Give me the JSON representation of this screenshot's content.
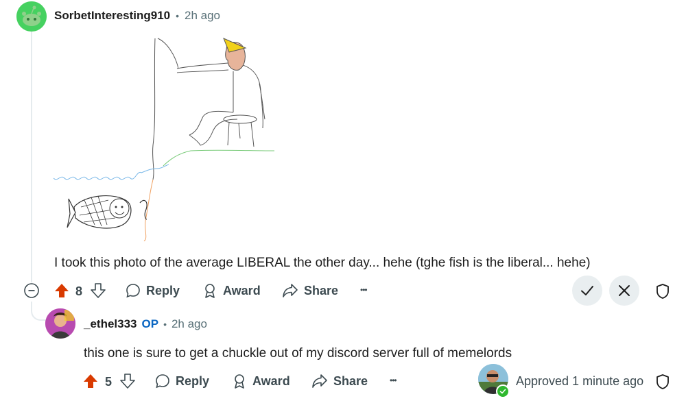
{
  "comment": {
    "username": "SorbetInteresting910",
    "separator": "•",
    "time": "2h ago",
    "text": "I took this photo of the average LIBERAL the other day... hehe (tghe fish is the liberal... hehe)",
    "votes": "8",
    "actions": {
      "reply": "Reply",
      "award": "Award",
      "share": "Share",
      "more": "•••"
    }
  },
  "reply": {
    "username": "_ethel333",
    "op_badge": "OP",
    "separator": "•",
    "time": "2h ago",
    "text": "this one is sure to get a chuckle out of my discord server full of memelords",
    "votes": "5",
    "actions": {
      "reply": "Reply",
      "award": "Award",
      "share": "Share",
      "more": "•••"
    },
    "approved": "Approved 1 minute ago"
  },
  "colors": {
    "upvote": "#d93a00",
    "accent_op": "#0a66c2",
    "approved_check": "#2eb82e",
    "avatar_green": "#46d160"
  },
  "icons": {
    "collapse": "collapse-minus-icon",
    "upvote": "upvote-arrow-icon",
    "downvote": "downvote-arrow-icon",
    "reply": "chat-bubble-icon",
    "award": "award-ribbon-icon",
    "share": "share-arrow-icon",
    "approve": "checkmark-icon",
    "remove": "close-x-icon",
    "mod": "shield-icon"
  }
}
